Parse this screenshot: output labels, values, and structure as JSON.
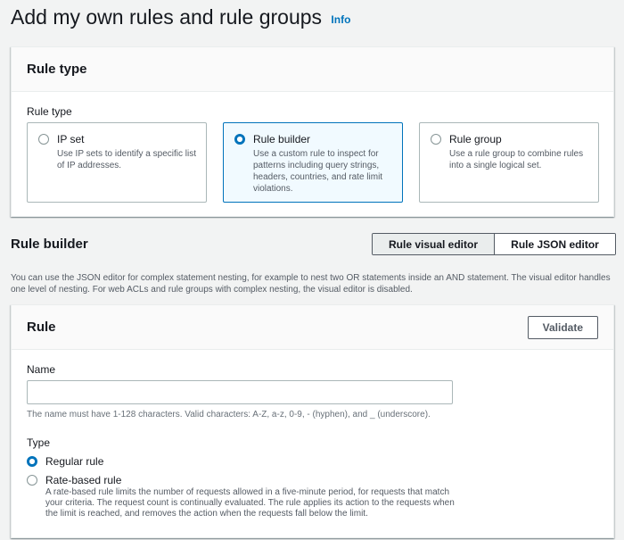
{
  "page": {
    "title": "Add my own rules and rule groups",
    "info_label": "Info"
  },
  "rule_type_panel": {
    "header": "Rule type",
    "field_label": "Rule type",
    "options": [
      {
        "title": "IP set",
        "description": "Use IP sets to identify a specific list of IP addresses.",
        "selected": false
      },
      {
        "title": "Rule builder",
        "description": "Use a custom rule to inspect for patterns including query strings, headers, countries, and rate limit violations.",
        "selected": true
      },
      {
        "title": "Rule group",
        "description": "Use a rule group to combine rules into a single logical set.",
        "selected": false
      }
    ]
  },
  "rule_builder": {
    "title": "Rule builder",
    "editor_modes": [
      "Rule visual editor",
      "Rule JSON editor"
    ],
    "active_mode": "Rule visual editor",
    "help_text": "You can use the JSON editor for complex statement nesting, for example to nest two OR statements inside an AND statement. The visual editor handles one level of nesting. For web ACLs and rule groups with complex nesting, the visual editor is disabled."
  },
  "rule_panel": {
    "header": "Rule",
    "validate_label": "Validate",
    "name_label": "Name",
    "name_value": "",
    "name_constraint": "The name must have 1-128 characters. Valid characters: A-Z, a-z, 0-9, - (hyphen), and _ (underscore).",
    "type_label": "Type",
    "type_options": [
      {
        "label": "Regular rule",
        "selected": true,
        "description": ""
      },
      {
        "label": "Rate-based rule",
        "selected": false,
        "description": "A rate-based rule limits the number of requests allowed in a five-minute period, for requests that match your criteria. The request count is continually evaluated. The rule applies its action to the requests when the limit is reached, and removes the action when the requests fall below the limit."
      }
    ]
  },
  "colors": {
    "accent": "#0073bb",
    "background": "#f2f3f3",
    "selected_tile_bg": "#f1faff"
  }
}
